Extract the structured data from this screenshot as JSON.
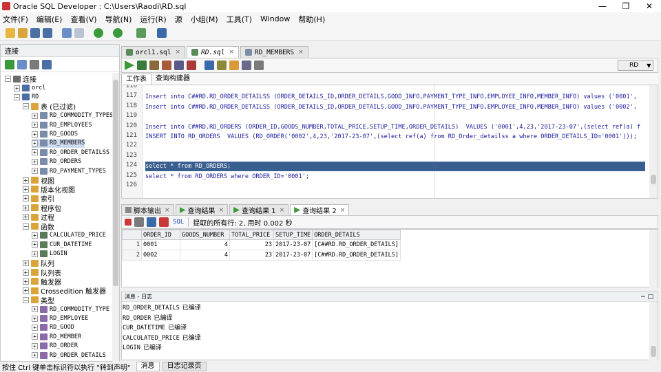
{
  "window": {
    "title": "Oracle SQL Developer : C:\\Users\\Raodi\\RD.sql",
    "controls": [
      "—",
      "❐",
      "✕"
    ]
  },
  "menu": [
    "文件(F)",
    "编辑(E)",
    "查看(V)",
    "导航(N)",
    "运行(R)",
    "源",
    "小组(M)",
    "工具(T)",
    "Window",
    "帮助(H)"
  ],
  "connections_panel": {
    "title": "连接",
    "tree": [
      {
        "label": "连接",
        "level": 0,
        "expanded": true,
        "icon": "connections-icon",
        "color": "#6b6b6b"
      },
      {
        "label": "orcl",
        "level": 1,
        "expanded": false,
        "icon": "database-icon",
        "color": "#4a6fa5",
        "mono": true
      },
      {
        "label": "RD",
        "level": 1,
        "expanded": true,
        "icon": "database-icon",
        "color": "#4a6fa5",
        "mono": true
      },
      {
        "label": "表 (已过滤)",
        "level": 2,
        "expanded": true,
        "icon": "folder-icon",
        "color": "#d9a53a"
      },
      {
        "label": "RD_COMMODITY_TYPES",
        "level": 3,
        "expanded": false,
        "icon": "table-icon",
        "color": "#7a8ca8",
        "mono": true
      },
      {
        "label": "RD_EMPLOYEES",
        "level": 3,
        "expanded": false,
        "icon": "table-icon",
        "color": "#7a8ca8",
        "mono": true
      },
      {
        "label": "RD_GOODS",
        "level": 3,
        "expanded": false,
        "icon": "table-icon",
        "color": "#7a8ca8",
        "mono": true
      },
      {
        "label": "RD_MEMBERS",
        "level": 3,
        "expanded": false,
        "icon": "table-icon",
        "color": "#7a8ca8",
        "mono": true,
        "selected": true
      },
      {
        "label": "RD_ORDER_DETAILSS",
        "level": 3,
        "expanded": false,
        "icon": "table-icon",
        "color": "#7a8ca8",
        "mono": true
      },
      {
        "label": "RD_ORDERS",
        "level": 3,
        "expanded": false,
        "icon": "table-icon",
        "color": "#7a8ca8",
        "mono": true
      },
      {
        "label": "RD_PAYMENT_TYPES",
        "level": 3,
        "expanded": false,
        "icon": "table-icon",
        "color": "#7a8ca8",
        "mono": true
      },
      {
        "label": "视图",
        "level": 2,
        "expanded": false,
        "icon": "folder-icon",
        "color": "#d9a53a"
      },
      {
        "label": "版本化视图",
        "level": 2,
        "expanded": false,
        "icon": "folder-icon",
        "color": "#d9a53a"
      },
      {
        "label": "索引",
        "level": 2,
        "expanded": false,
        "icon": "folder-icon",
        "color": "#d9a53a"
      },
      {
        "label": "程序包",
        "level": 2,
        "expanded": false,
        "icon": "folder-icon",
        "color": "#d9a53a"
      },
      {
        "label": "过程",
        "level": 2,
        "expanded": false,
        "icon": "folder-icon",
        "color": "#d9a53a"
      },
      {
        "label": "函数",
        "level": 2,
        "expanded": true,
        "icon": "folder-icon",
        "color": "#d9a53a"
      },
      {
        "label": "CALCULATED_PRICE",
        "level": 3,
        "expanded": false,
        "icon": "function-icon",
        "color": "#5a7a5a",
        "mono": true
      },
      {
        "label": "CUR_DATETIME",
        "level": 3,
        "expanded": false,
        "icon": "function-icon",
        "color": "#5a7a5a",
        "mono": true
      },
      {
        "label": "LOGIN",
        "level": 3,
        "expanded": false,
        "icon": "function-icon",
        "color": "#5a7a5a",
        "mono": true
      },
      {
        "label": "队列",
        "level": 2,
        "expanded": false,
        "icon": "folder-icon",
        "color": "#d9a53a"
      },
      {
        "label": "队列表",
        "level": 2,
        "expanded": false,
        "icon": "folder-icon",
        "color": "#d9a53a"
      },
      {
        "label": "触发器",
        "level": 2,
        "expanded": false,
        "icon": "folder-icon",
        "color": "#d9a53a"
      },
      {
        "label": "Crossedition 触发器",
        "level": 2,
        "expanded": false,
        "icon": "folder-icon",
        "color": "#d9a53a"
      },
      {
        "label": "类型",
        "level": 2,
        "expanded": true,
        "icon": "folder-icon",
        "color": "#d9a53a"
      },
      {
        "label": "RD_COMMODITY_TYPE",
        "level": 3,
        "expanded": false,
        "icon": "type-icon",
        "color": "#8a6aa8",
        "mono": true
      },
      {
        "label": "RD_EMPLOYEE",
        "level": 3,
        "expanded": false,
        "icon": "type-icon",
        "color": "#8a6aa8",
        "mono": true
      },
      {
        "label": "RD_GOOD",
        "level": 3,
        "expanded": false,
        "icon": "type-icon",
        "color": "#8a6aa8",
        "mono": true
      },
      {
        "label": "RD_MEMBER",
        "level": 3,
        "expanded": false,
        "icon": "type-icon",
        "color": "#8a6aa8",
        "mono": true
      },
      {
        "label": "RD_ORDER",
        "level": 3,
        "expanded": false,
        "icon": "type-icon",
        "color": "#8a6aa8",
        "mono": true
      },
      {
        "label": "RD_ORDER_DETAILS",
        "level": 3,
        "expanded": false,
        "icon": "type-icon",
        "color": "#8a6aa8",
        "mono": true
      }
    ]
  },
  "editor": {
    "tabs": [
      {
        "label": "orcl1.sql",
        "active": false
      },
      {
        "label": "RD.sql",
        "active": true
      },
      {
        "label": "RD_MEMBERS",
        "active": false
      }
    ],
    "connection": "RD",
    "subtabs": [
      "工作表",
      "查询构建器"
    ],
    "lines": [
      {
        "n": "116",
        "text": ""
      },
      {
        "n": "117",
        "text": "Insert into C##RD.RD_ORDER_DETAILSS (ORDER_DETAILS_ID,ORDER_DETAILS,GOOD_INFO,PAYMENT_TYPE_INFO,EMPLOYEE_INFO,MEMBER_INFO) values ('0001',"
      },
      {
        "n": "118",
        "text": "Insert into C##RD.RD_ORDER_DETAILSS (ORDER_DETAILS_ID,ORDER_DETAILS,GOOD_INFO,PAYMENT_TYPE_INFO,EMPLOYEE_INFO,MEMBER_INFO) values ('0002',"
      },
      {
        "n": "119",
        "text": ""
      },
      {
        "n": "120",
        "text": "Insert into C##RD.RD_ORDERS (ORDER_ID,GOODS_NUMBER,TOTAL_PRICE,SETUP_TIME,ORDER_DETAILS)  VALUES ('0001',4,23,'2017-23-07',(select ref(a) f"
      },
      {
        "n": "121",
        "text": "INSERT INTO RD_ORDERS  VALUES (RD_ORDER('0002',4,23,'2017-23-07',(select ref(a) from RD_Order_detailss a where ORDER_DETAILS_ID='0001')));"
      },
      {
        "n": "122",
        "text": ""
      },
      {
        "n": "123",
        "text": ""
      },
      {
        "n": "124",
        "text": "select * from RD_ORDERS;",
        "highlight": true
      },
      {
        "n": "125",
        "text": "select * from RD_ORDERS where ORDER_ID='0001';"
      },
      {
        "n": "126",
        "text": ""
      }
    ]
  },
  "results": {
    "tabs": [
      {
        "label": "脚本输出",
        "icon": "doc",
        "active": false
      },
      {
        "label": "查询结果",
        "icon": "run",
        "active": false
      },
      {
        "label": "查询结果 1",
        "icon": "run",
        "active": false
      },
      {
        "label": "查询结果 2",
        "icon": "run",
        "active": true
      }
    ],
    "sql_label": "SQL",
    "message": "提取的所有行: 2, 用时 0.002 秒",
    "columns": [
      "ORDER_ID",
      "GOODS_NUMBER",
      "TOTAL_PRICE",
      "SETUP_TIME",
      "ORDER_DETAILS"
    ],
    "rows": [
      {
        "rn": "1",
        "cells": [
          "0001",
          "4",
          "23",
          "2017-23-07",
          "[C##RD.RD_ORDER_DETAILS]"
        ]
      },
      {
        "rn": "2",
        "cells": [
          "0002",
          "4",
          "23",
          "2017-23-07",
          "[C##RD.RD_ORDER_DETAILS]"
        ]
      }
    ]
  },
  "log": {
    "title": "消息 - 日志",
    "lines": [
      {
        "code": "RD_ORDER_DETAILS",
        "status": "已编译"
      },
      {
        "code": "RD_ORDER",
        "status": "已编译"
      },
      {
        "code": "CUR_DATETIME",
        "status": "已编译"
      },
      {
        "code": "CALCULATED_PRICE",
        "status": "已编译"
      },
      {
        "code": "LOGIN",
        "status": "已编译"
      }
    ]
  },
  "statusbar": {
    "hint": "按住 Ctrl 键单击标识符以执行 \"转到声明\"",
    "tabs": [
      "消息",
      "日志记录页"
    ]
  }
}
